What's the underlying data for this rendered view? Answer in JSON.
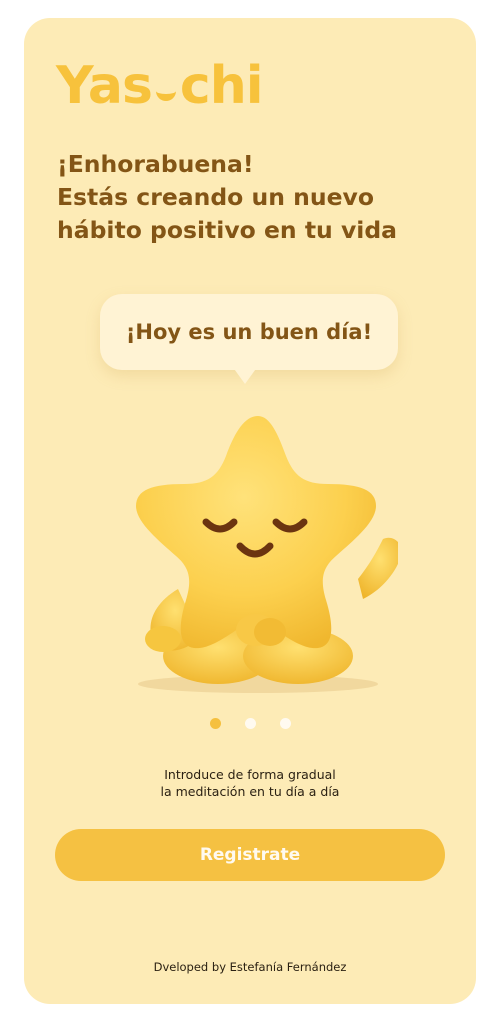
{
  "app": {
    "logo_text_left": "Yas",
    "logo_text_right": "chi"
  },
  "headline": {
    "line1": "¡Enhorabuena!",
    "line2": "Estás creando un nuevo",
    "line3": "hábito positivo en tu vida"
  },
  "bubble": {
    "text": "¡Hoy es un buen día!"
  },
  "pagination": {
    "total": 3,
    "active_index": 0
  },
  "subtitle": {
    "line1": "Introduce de forma gradual",
    "line2": "la meditación en tu día a día"
  },
  "cta": {
    "label": "Registrate"
  },
  "footer": {
    "credit": "Dveloped by Estefanía Fernández"
  },
  "colors": {
    "background": "#fdebb6",
    "brand_yellow": "#f7c23c",
    "heading_brown": "#835516",
    "button": "#f5c142",
    "bubble": "#fff3d4"
  },
  "mascot": {
    "icon": "meditating-star-mascot"
  }
}
